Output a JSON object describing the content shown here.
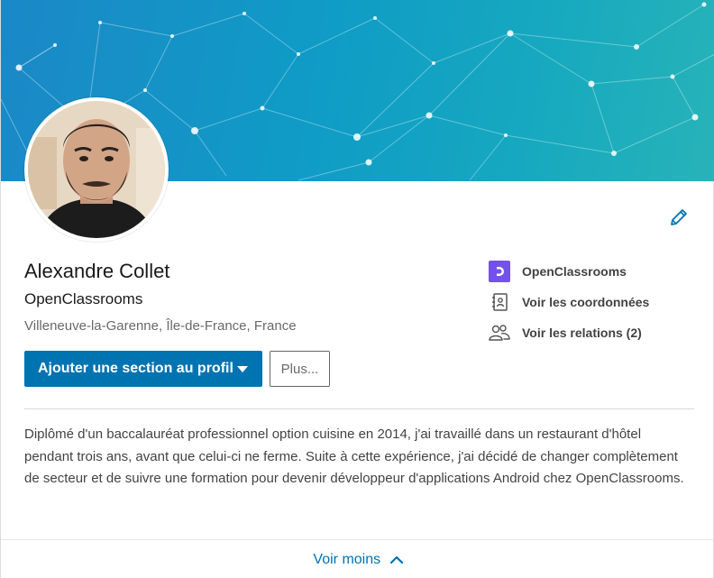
{
  "profile": {
    "name": "Alexandre Collet",
    "headline": "OpenClassrooms",
    "location": "Villeneuve-la-Garenne, Île-de-France, France"
  },
  "actions": {
    "primary_label": "Ajouter une section au profil",
    "more_label": "Plus..."
  },
  "side_links": {
    "school": "OpenClassrooms",
    "contact_info": "Voir les coordonnées",
    "connections": "Voir les relations (2)"
  },
  "summary": "Diplômé d'un baccalauréat professionnel option cuisine en 2014, j'ai travaillé dans un restaurant d'hôtel pendant trois ans, avant que celui-ci ne ferme. Suite à cette expérience, j'ai décidé de changer complètement de secteur et de suivre une formation pour devenir développeur d'applications Android chez OpenClassrooms.",
  "footer": {
    "see_less": "Voir moins"
  },
  "icons": {
    "edit": "pencil-icon",
    "school": "openclassrooms-logo-icon",
    "contact": "contact-book-icon",
    "connections": "people-icon",
    "see_less": "chevron-up-icon"
  },
  "colors": {
    "primary": "#0073b1",
    "school_logo": "#7451eb",
    "banner_start": "#1b88c7",
    "banner_end": "#27b3b8"
  }
}
